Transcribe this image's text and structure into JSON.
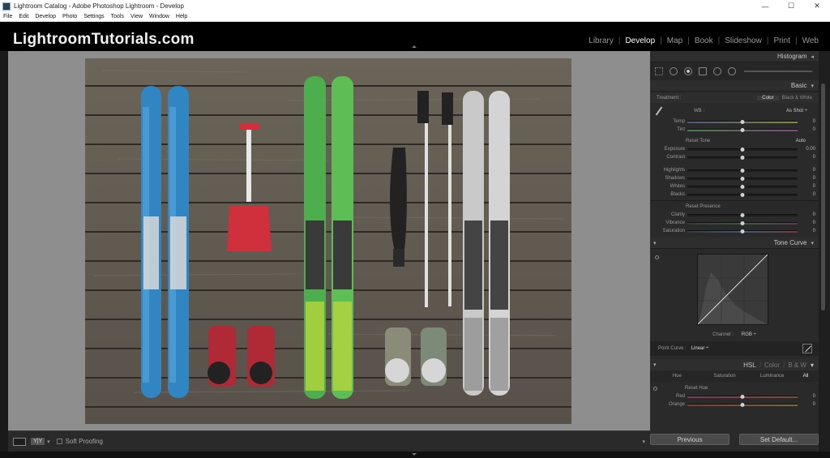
{
  "window": {
    "title": "Lightroom Catalog - Adobe Photoshop Lightroom - Develop",
    "controls": [
      "—",
      "☐",
      "✕"
    ]
  },
  "menu": [
    "File",
    "Edit",
    "Develop",
    "Photo",
    "Settings",
    "Tools",
    "View",
    "Window",
    "Help"
  ],
  "identity_plate": "LightroomTutorials.com",
  "modules": [
    {
      "label": "Library",
      "active": false
    },
    {
      "label": "Develop",
      "active": true
    },
    {
      "label": "Map",
      "active": false
    },
    {
      "label": "Book",
      "active": false
    },
    {
      "label": "Slideshow",
      "active": false
    },
    {
      "label": "Print",
      "active": false
    },
    {
      "label": "Web",
      "active": false
    }
  ],
  "toolbar": {
    "view_icon": "loupe-view-icon",
    "compare_label": "Y|Y",
    "soft_proofing_label": "Soft Proofing"
  },
  "panels": {
    "histogram": {
      "title": "Histogram"
    },
    "basic": {
      "title": "Basic",
      "treatment_label": "Treatment :",
      "treatment_color": "Color",
      "treatment_bw": "Black & White",
      "wb_label": "WB :",
      "wb_value": "As Shot ÷",
      "tone_label": "Reset Tone",
      "auto_label": "Auto",
      "presence_label": "Reset Presence",
      "sliders_wb": [
        {
          "label": "Temp",
          "value": "0",
          "pos": 0.5
        },
        {
          "label": "Tint",
          "value": "0",
          "pos": 0.5
        }
      ],
      "sliders_tone1": [
        {
          "label": "Exposure",
          "value": "0.00",
          "pos": 0.5
        },
        {
          "label": "Contrast",
          "value": "0",
          "pos": 0.5
        }
      ],
      "sliders_tone2": [
        {
          "label": "Highlights",
          "value": "0",
          "pos": 0.5
        },
        {
          "label": "Shadows",
          "value": "0",
          "pos": 0.5
        },
        {
          "label": "Whites",
          "value": "0",
          "pos": 0.5
        },
        {
          "label": "Blacks",
          "value": "0",
          "pos": 0.5
        }
      ],
      "sliders_presence": [
        {
          "label": "Clarity",
          "value": "0",
          "pos": 0.5
        },
        {
          "label": "Vibrance",
          "value": "0",
          "pos": 0.5
        },
        {
          "label": "Saturation",
          "value": "0",
          "pos": 0.5
        }
      ]
    },
    "tone_curve": {
      "title": "Tone Curve",
      "channel_label": "Channel :",
      "channel_value": "RGB ÷",
      "point_curve_label": "Point Curve :",
      "point_curve_value": "Linear ÷"
    },
    "hsl": {
      "title_hsl": "HSL",
      "title_color": "Color",
      "title_bw": "B & W",
      "tabs": [
        "Hue",
        "Saturation",
        "Luminance",
        "All"
      ],
      "reset_label": "Reset Hue",
      "sliders": [
        {
          "label": "Red",
          "value": "0",
          "pos": 0.5
        },
        {
          "label": "Orange",
          "value": "0",
          "pos": 0.5
        }
      ]
    }
  },
  "buttons": {
    "previous": "Previous",
    "set_default": "Set Default..."
  }
}
